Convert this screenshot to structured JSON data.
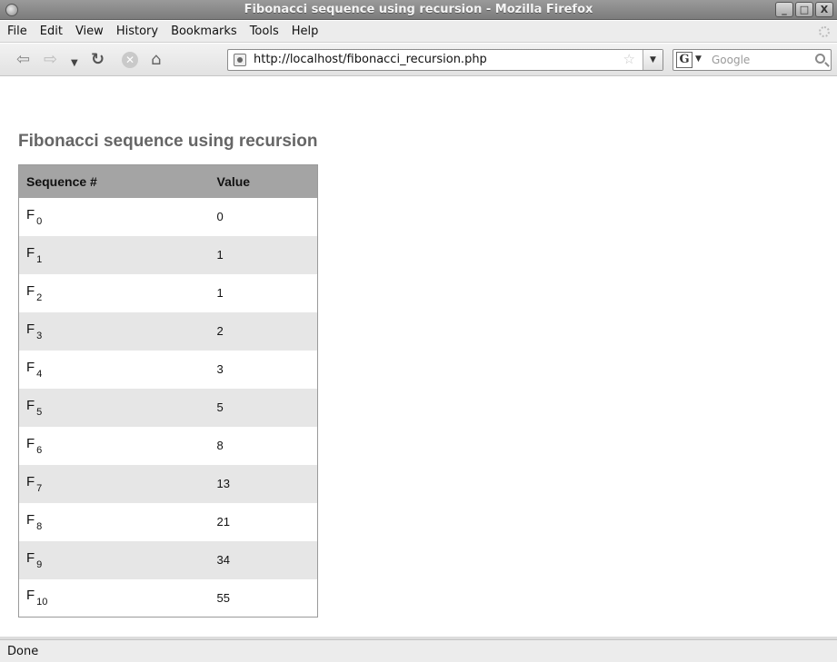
{
  "window": {
    "title": "Fibonacci sequence using recursion - Mozilla Firefox",
    "minimize": "_",
    "maximize": "□",
    "close": "X"
  },
  "menu": {
    "items": [
      "File",
      "Edit",
      "View",
      "History",
      "Bookmarks",
      "Tools",
      "Help"
    ]
  },
  "toolbar": {
    "url": "http://localhost/fibonacci_recursion.php",
    "search_placeholder": "Google",
    "search_engine_letter": "G"
  },
  "page": {
    "title": "Fibonacci sequence using recursion",
    "table": {
      "headers": [
        "Sequence #",
        "Value"
      ],
      "rows": [
        {
          "letter": "F",
          "index": "0",
          "value": "0"
        },
        {
          "letter": "F",
          "index": "1",
          "value": "1"
        },
        {
          "letter": "F",
          "index": "2",
          "value": "1"
        },
        {
          "letter": "F",
          "index": "3",
          "value": "2"
        },
        {
          "letter": "F",
          "index": "4",
          "value": "3"
        },
        {
          "letter": "F",
          "index": "5",
          "value": "5"
        },
        {
          "letter": "F",
          "index": "6",
          "value": "8"
        },
        {
          "letter": "F",
          "index": "7",
          "value": "13"
        },
        {
          "letter": "F",
          "index": "8",
          "value": "21"
        },
        {
          "letter": "F",
          "index": "9",
          "value": "34"
        },
        {
          "letter": "F",
          "index": "10",
          "value": "55"
        }
      ]
    }
  },
  "status": {
    "text": "Done"
  },
  "icons": {
    "back": "back-arrow-icon",
    "forward": "forward-arrow-icon",
    "reload": "reload-icon",
    "stop": "stop-icon",
    "home": "home-icon",
    "bookmark": "star-icon",
    "search": "magnifier-icon"
  }
}
